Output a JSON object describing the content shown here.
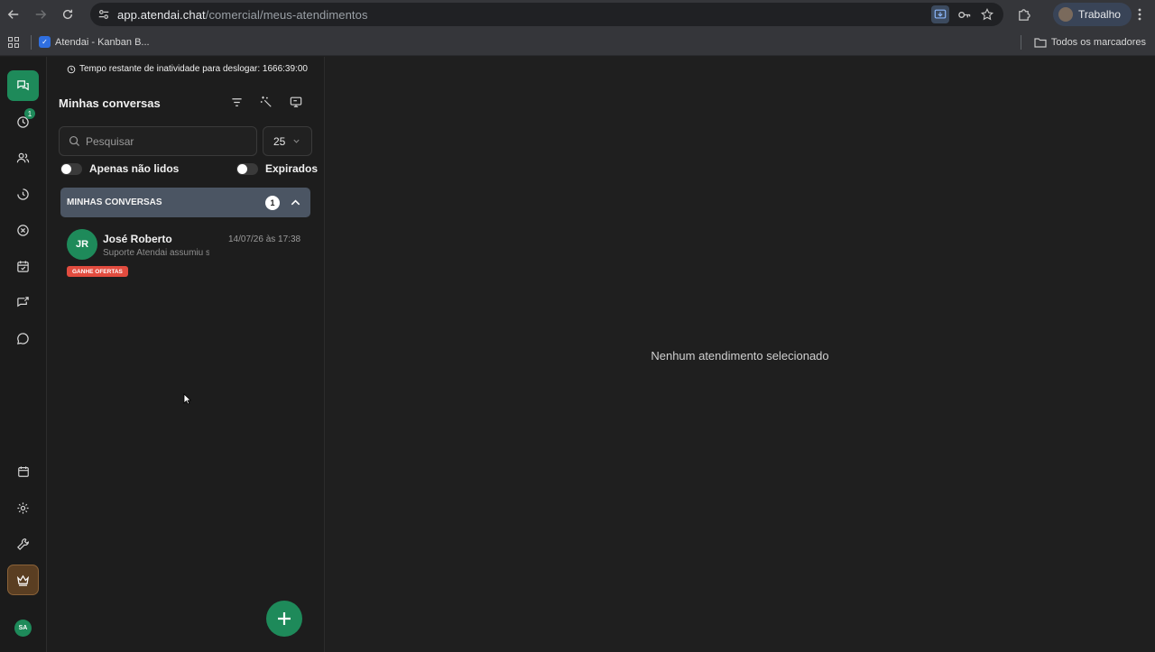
{
  "browser": {
    "url_host": "app.atendai.chat",
    "url_path": "/comercial/meus-atendimentos",
    "profile_label": "Trabalho",
    "bookmarks": [
      {
        "label": "Atendai - Kanban B..."
      }
    ],
    "all_bookmarks_label": "Todos os marcadores"
  },
  "rail": {
    "items": [
      {
        "icon": "chats-icon",
        "active": true
      },
      {
        "icon": "clock-badge-icon",
        "badge": "1"
      },
      {
        "icon": "users-icon"
      },
      {
        "icon": "history-icon"
      },
      {
        "icon": "close-circle-icon"
      },
      {
        "icon": "calendar-check-icon"
      },
      {
        "icon": "message-arrow-icon"
      },
      {
        "icon": "whatsapp-icon"
      },
      {
        "icon": "calendar-icon"
      },
      {
        "icon": "gear-icon"
      },
      {
        "icon": "wrench-icon"
      },
      {
        "icon": "crown-icon"
      }
    ],
    "avatar_initials": "SA"
  },
  "panel": {
    "inactivity_text": "Tempo restante de inatividade para deslogar: 1666:39:00",
    "title": "Minhas conversas",
    "search_placeholder": "Pesquisar",
    "page_size": "25",
    "toggle_unread": "Apenas não lidos",
    "toggle_expired": "Expirados",
    "group": {
      "label": "MINHAS CONVERSAS",
      "count": "1"
    },
    "conversations": [
      {
        "initials": "JR",
        "name": "José Roberto",
        "date": "14/07/26 às 17:38",
        "preview": "Suporte Atendai assumiu s",
        "tag": "GANHE OFERTAS"
      }
    ]
  },
  "main": {
    "empty_message": "Nenhum atendimento selecionado"
  },
  "colors": {
    "accent": "#1e8a5a",
    "tag": "#e24c3f",
    "group_header": "#4b5563"
  }
}
